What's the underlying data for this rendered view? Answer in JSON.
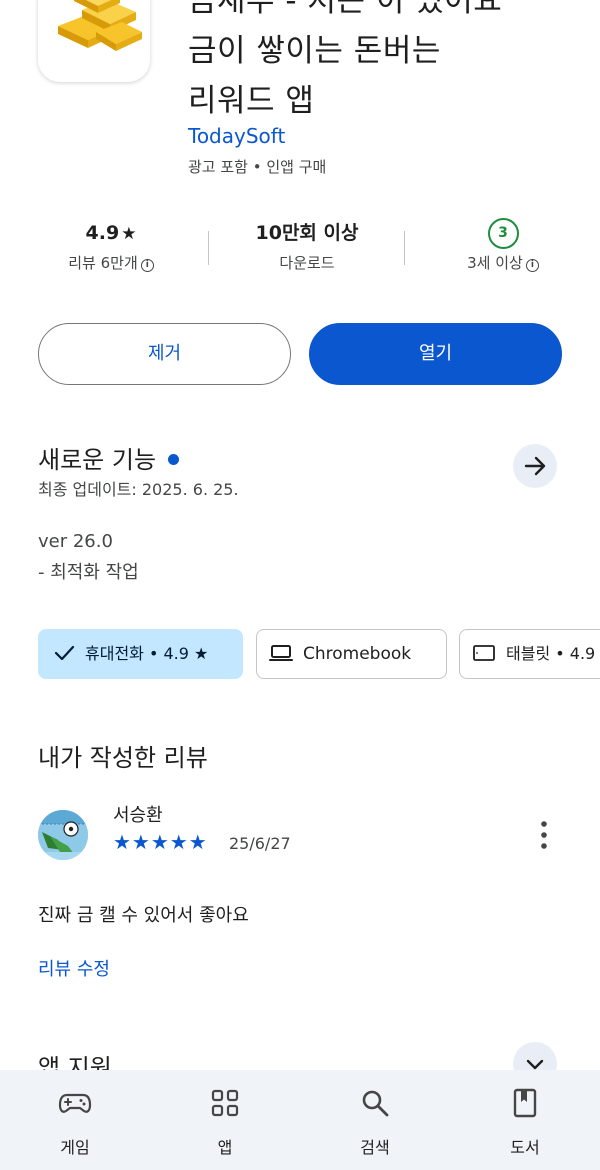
{
  "app": {
    "title_lines": [
      "금새부 - 저는 이 있어요",
      "금이 쌓이는 돈버는",
      "리워드 앱"
    ],
    "developer": "TodaySoft",
    "meta": "광고 포함 • 인앱 구매"
  },
  "stats": {
    "rating": "4.9",
    "reviews": "리뷰 6만개",
    "downloads": "10만회 이상",
    "downloads_label": "다운로드",
    "age_badge": "3",
    "age_label": "3세 이상"
  },
  "buttons": {
    "remove": "제거",
    "open": "열기"
  },
  "whats_new": {
    "title": "새로운 기능",
    "updated": "최종 업데이트: 2025. 6. 25.",
    "version": "ver 26.0",
    "note": "- 최적화 작업"
  },
  "chips": {
    "phone": "휴대전화 • 4.9 ★",
    "chromebook": "Chromebook",
    "tablet": "태블릿 • 4.9"
  },
  "my_review": {
    "title": "내가 작성한 리뷰",
    "reviewer": "서승환",
    "stars": "★★★★★",
    "date": "25/6/27",
    "text": "진짜 금 캘 수 있어서 좋아요",
    "edit": "리뷰 수정"
  },
  "app_support": {
    "title": "앱 지원"
  },
  "nav": {
    "games": "게임",
    "apps": "앱",
    "search": "검색",
    "books": "도서"
  },
  "colors": {
    "accent": "#0b57d0",
    "chip_selected": "#c2e7ff",
    "age_green": "#1e8e3e",
    "nav_bg": "#f0f4f9"
  }
}
